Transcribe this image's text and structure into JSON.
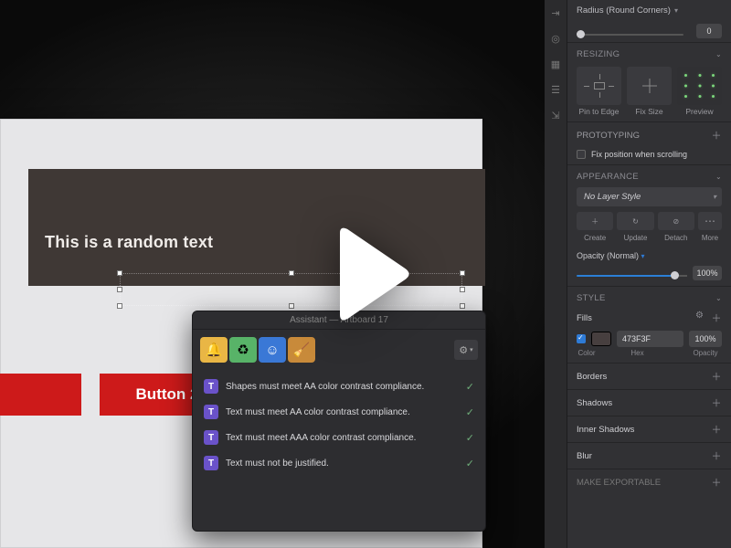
{
  "canvas": {
    "sample_text": "This is a random text",
    "button2_label": "Button 2"
  },
  "a11y": {
    "title": "Assistant — Artboard 17",
    "rules": [
      "Shapes must meet AA color contrast compliance.",
      "Text must meet AA color contrast compliance.",
      "Text must meet AAA color contrast compliance.",
      "Text must not be justified."
    ],
    "badge_char": "T"
  },
  "inspector": {
    "radius_label": "Radius (Round Corners)",
    "radius_value": "0",
    "resizing_header": "RESIZING",
    "resize_labels": {
      "pin": "Pin to Edge",
      "fix": "Fix Size",
      "preview": "Preview"
    },
    "prototyping_header": "PROTOTYPING",
    "fix_scroll_label": "Fix position when scrolling",
    "appearance_header": "APPEARANCE",
    "layer_style_label": "No Layer Style",
    "btns": {
      "create": "Create",
      "update": "Update",
      "detach": "Detach",
      "more": "More"
    },
    "opacity_label": "Opacity (Normal)",
    "opacity_value": "100%",
    "style_header": "STYLE",
    "fills_label": "Fills",
    "fill_hex": "473F3F",
    "fill_opacity": "100%",
    "fill_sub": {
      "color": "Color",
      "hex": "Hex",
      "opacity": "Opacity"
    },
    "rows": {
      "borders": "Borders",
      "shadows": "Shadows",
      "inner_shadows": "Inner Shadows",
      "blur": "Blur",
      "export": "MAKE EXPORTABLE"
    }
  }
}
